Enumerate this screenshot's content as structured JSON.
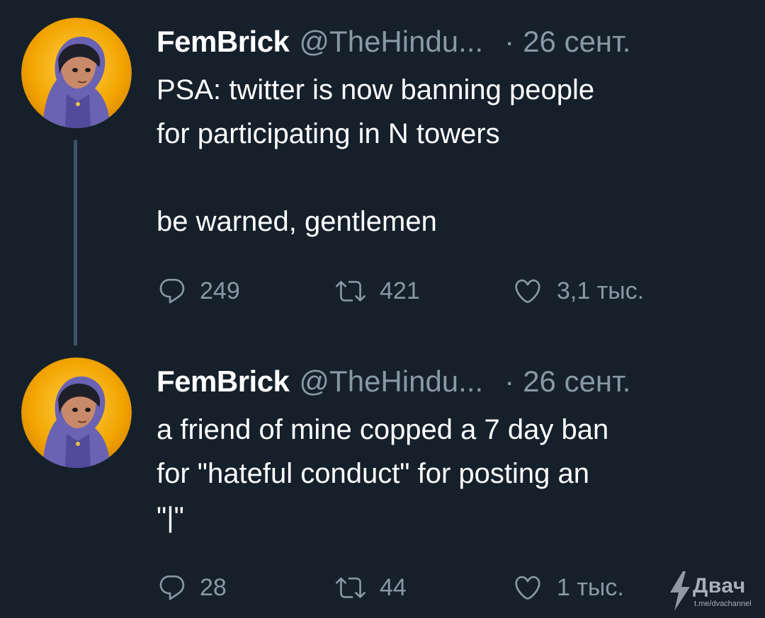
{
  "tweets": [
    {
      "display_name": "FemBrick",
      "handle": "@TheHindu...",
      "separator": "·",
      "date": "26 сент.",
      "lines": [
        "PSA: twitter is now banning people",
        "for participating in N towers",
        "",
        "be warned, gentlemen"
      ],
      "replies": "249",
      "retweets": "421",
      "likes": "3,1 тыс."
    },
    {
      "display_name": "FemBrick",
      "handle": "@TheHindu...",
      "separator": "·",
      "date": "26 сент.",
      "lines": [
        "a friend of mine copped a 7 day ban",
        "for \"hateful conduct\" for posting an",
        "\"|\""
      ],
      "replies": "28",
      "retweets": "44",
      "likes": "1 тыс."
    }
  ],
  "icons": {
    "reply": "reply-icon",
    "retweet": "retweet-icon",
    "like": "heart-icon"
  },
  "watermark": {
    "name": "Двач",
    "url": "t.me/dvachannel"
  },
  "colors": {
    "background": "#15202b",
    "secondary_text": "#8899a6",
    "primary_text": "#ffffff",
    "thread_line": "#3d5466"
  }
}
